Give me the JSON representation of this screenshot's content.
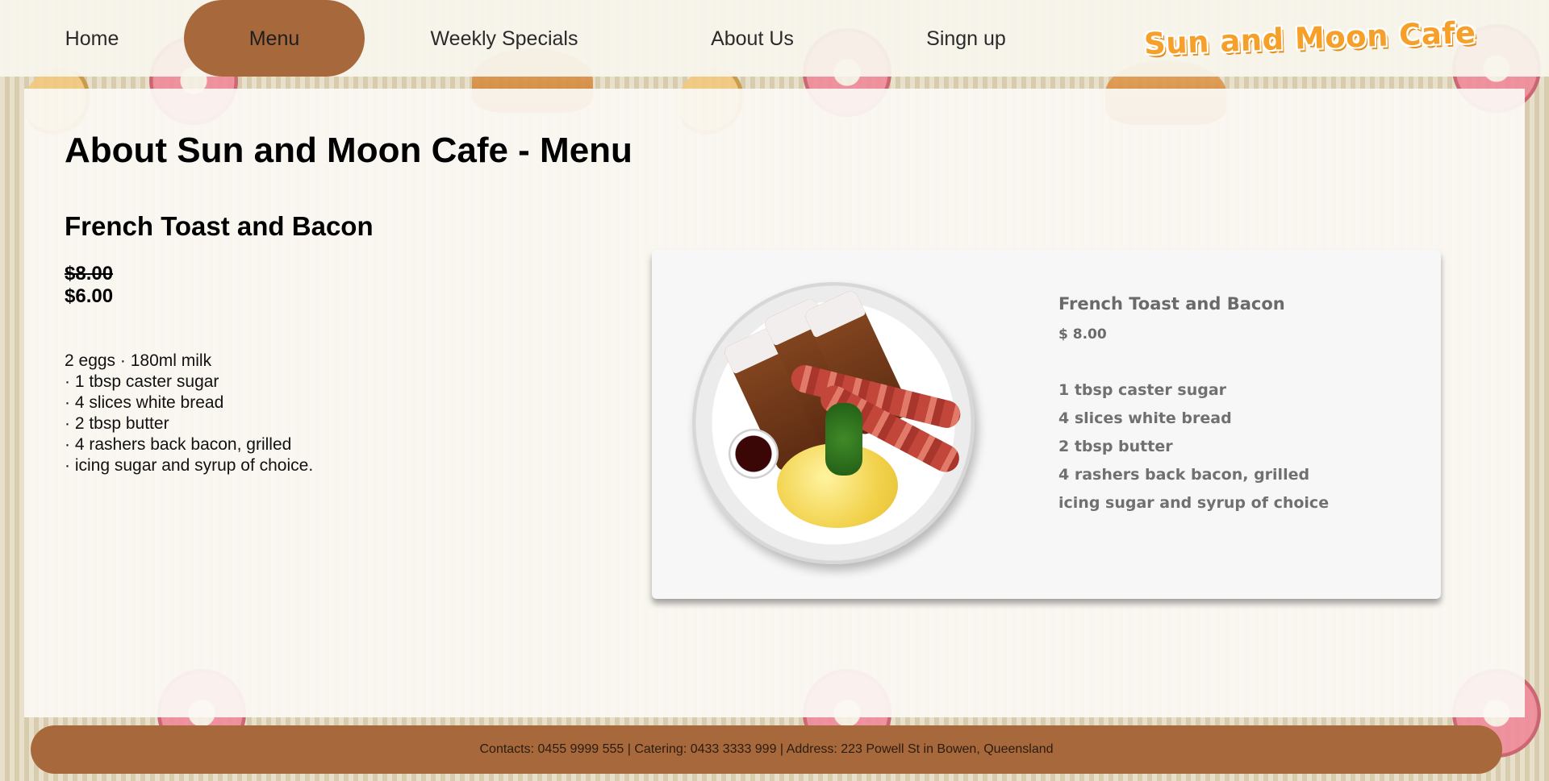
{
  "nav": {
    "items": [
      {
        "label": "Home"
      },
      {
        "label": "Menu",
        "active": true
      },
      {
        "label": "Weekly Specials"
      },
      {
        "label": "About Us"
      },
      {
        "label": "Singn up"
      }
    ]
  },
  "logo": {
    "text": "Sun and Moon Cafe"
  },
  "main": {
    "page_title": "About Sun and Moon Cafe - Menu",
    "dish_title": "French Toast and Bacon",
    "price_old": "$8.00",
    "price_new": "$6.00",
    "ingredients": [
      "2 eggs · 180ml milk",
      "· 1 tbsp caster sugar",
      "· 4 slices white bread",
      "· 2 tbsp butter",
      "· 4 rashers back bacon, grilled",
      "· icing sugar and syrup of choice."
    ]
  },
  "card": {
    "title": "French Toast and Bacon",
    "price": "$ 8.00",
    "items": [
      "1 tbsp caster sugar",
      "4 slices white bread",
      "2 tbsp butter",
      "4 rashers back bacon, grilled",
      "icing sugar and syrup of choice"
    ]
  },
  "footer": {
    "text": "Contacts: 0455 9999 555 | Catering: 0433 3333 999 | Address: 223 Powell St in Bowen, Queensland"
  },
  "colors": {
    "accent": "#a7693b",
    "logo": "#f6a02a",
    "panel": "#fbf9f4"
  }
}
